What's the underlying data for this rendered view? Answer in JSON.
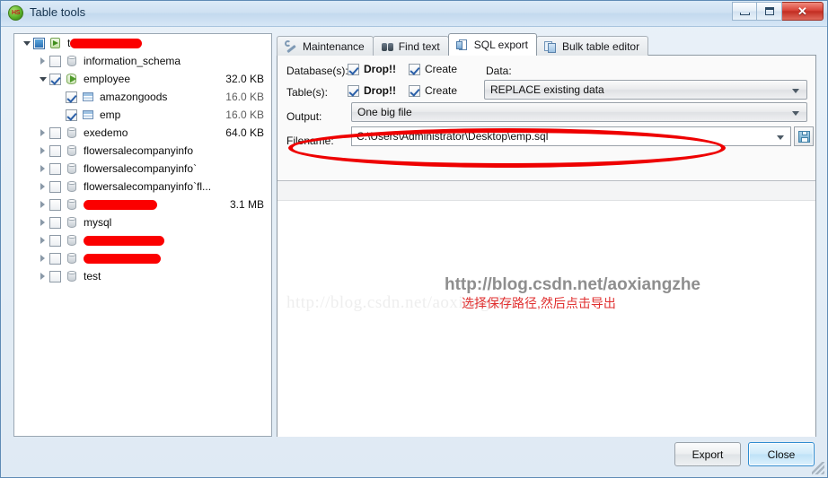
{
  "window": {
    "title": "Table tools",
    "icon": "heidisql-icon",
    "icon_text": "HS",
    "controls": {
      "minimize": "minimize-button",
      "restore": "restore-button",
      "close": "close-button",
      "close_glyph": "✕"
    }
  },
  "tree": {
    "nodes": [
      {
        "label": "t",
        "redacted": true,
        "redact_width": 80,
        "indent": 0,
        "expander": "open",
        "check": "partial",
        "icon": "server-icon",
        "size": ""
      },
      {
        "label": "information_schema",
        "redacted": false,
        "redact_width": 0,
        "indent": 1,
        "expander": "closed",
        "check": "none",
        "icon": "database-icon",
        "size": ""
      },
      {
        "label": "employee",
        "redacted": false,
        "redact_width": 0,
        "indent": 1,
        "expander": "open",
        "check": "checked",
        "icon": "database-open-icon",
        "size": "32.0 KB",
        "size_dim": false
      },
      {
        "label": "amazongoods",
        "redacted": false,
        "redact_width": 0,
        "indent": 2,
        "expander": "none",
        "check": "checked",
        "icon": "table-icon",
        "size": "16.0 KB",
        "size_dim": true
      },
      {
        "label": "emp",
        "redacted": false,
        "redact_width": 0,
        "indent": 2,
        "expander": "none",
        "check": "checked",
        "icon": "table-icon",
        "size": "16.0 KB",
        "size_dim": true
      },
      {
        "label": "exedemo",
        "redacted": false,
        "redact_width": 0,
        "indent": 1,
        "expander": "closed",
        "check": "none",
        "icon": "database-icon",
        "size": "64.0 KB",
        "size_dim": false
      },
      {
        "label": "flowersalecompanyinfo",
        "redacted": false,
        "redact_width": 0,
        "indent": 1,
        "expander": "closed",
        "check": "none",
        "icon": "database-icon",
        "size": ""
      },
      {
        "label": "flowersalecompanyinfo`",
        "redacted": false,
        "redact_width": 0,
        "indent": 1,
        "expander": "closed",
        "check": "none",
        "icon": "database-icon",
        "size": ""
      },
      {
        "label": "flowersalecompanyinfo`fl...",
        "redacted": false,
        "redact_width": 0,
        "indent": 1,
        "expander": "closed",
        "check": "none",
        "icon": "database-icon",
        "size": ""
      },
      {
        "label": "",
        "redacted": true,
        "redact_width": 82,
        "indent": 1,
        "expander": "closed",
        "check": "none",
        "icon": "database-icon",
        "size": "3.1 MB",
        "size_dim": false
      },
      {
        "label": "mysql",
        "redacted": false,
        "redact_width": 0,
        "indent": 1,
        "expander": "closed",
        "check": "none",
        "icon": "database-icon",
        "size": ""
      },
      {
        "label": "",
        "redacted": true,
        "redact_width": 90,
        "indent": 1,
        "expander": "closed",
        "check": "none",
        "icon": "database-icon",
        "size": ""
      },
      {
        "label": "",
        "redacted": true,
        "redact_width": 86,
        "indent": 1,
        "expander": "closed",
        "check": "none",
        "icon": "database-icon",
        "size": ""
      },
      {
        "label": "test",
        "redacted": false,
        "redact_width": 0,
        "indent": 1,
        "expander": "closed",
        "check": "none",
        "icon": "database-icon",
        "size": ""
      }
    ]
  },
  "tabs": [
    {
      "label": "Maintenance",
      "icon": "wrench-icon",
      "active": false
    },
    {
      "label": "Find text",
      "icon": "binoculars-icon",
      "active": false
    },
    {
      "label": "SQL export",
      "icon": "document-icon",
      "active": true
    },
    {
      "label": "Bulk table editor",
      "icon": "stacked-documents-icon",
      "active": false
    }
  ],
  "form": {
    "databases_label": "Database(s):",
    "tables_label": "Table(s):",
    "output_label": "Output:",
    "filename_label": "Filename:",
    "data_label": "Data:",
    "db_drop": {
      "label": "Drop!!",
      "checked": true
    },
    "db_create": {
      "label": "Create",
      "checked": true
    },
    "tbl_drop": {
      "label": "Drop!!",
      "checked": true
    },
    "tbl_create": {
      "label": "Create",
      "checked": true
    },
    "data_value": "REPLACE existing data",
    "output_value": "One big file",
    "filename_value": "C:\\Users\\Administrator\\Desktop\\emp.sql",
    "save_icon": "floppy-disk-icon"
  },
  "annotations": {
    "watermark_serif": "http://blog.csdn.net/aoxiangzhe",
    "watermark_bold": "http://blog.csdn.net/aoxiangzhe",
    "chinese_note": "选择保存路径,然后点击导出",
    "highlight_color": "#ee0000"
  },
  "footer": {
    "export_label": "Export",
    "close_label": "Close"
  }
}
